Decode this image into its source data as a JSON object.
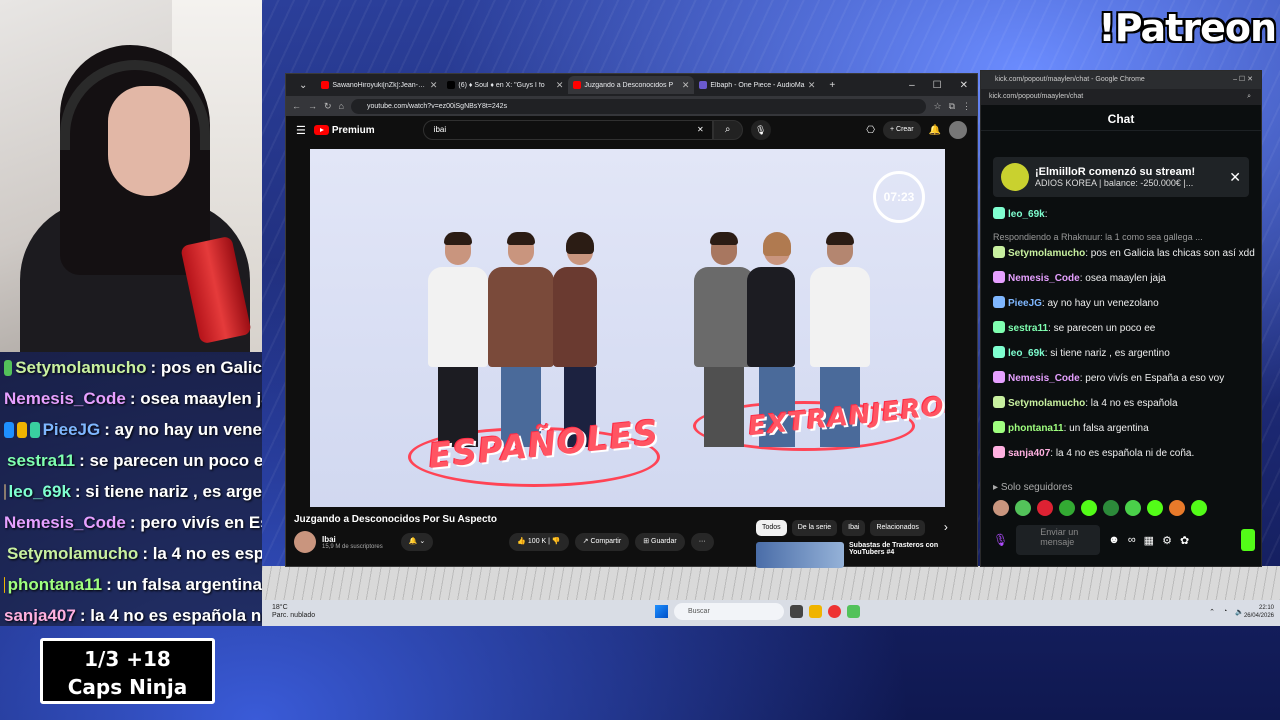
{
  "overlay": {
    "patreon_text": "!Patreon",
    "ninja": {
      "line1": "1/3   +18",
      "line2": "Caps Ninja"
    }
  },
  "left_chat": [
    {
      "user": "Setymolamucho",
      "text": ": pos en Galic",
      "color": "#c8f0a0",
      "badges": [
        "#53c25a"
      ]
    },
    {
      "user": "Nemesis_Code",
      "text": ": osea maaylen jaj",
      "color": "#e6a0ff",
      "badges": []
    },
    {
      "user": "PieeJG",
      "text": ": ay no hay un vene",
      "color": "#7fb7ff",
      "badges": [
        "#1e90ff",
        "#f0b400",
        "#39d0a0"
      ]
    },
    {
      "user": "sestra11",
      "text": ": se parecen un poco e",
      "color": "#7fffb0",
      "badges": [
        "#8a7b6d"
      ]
    },
    {
      "user": "leo_69k",
      "text": ": si tiene nariz , es arge",
      "color": "#7fffd0",
      "badges": [
        "#8a7b6d"
      ]
    },
    {
      "user": "Nemesis_Code",
      "text": ": pero vivís en Esp",
      "color": "#e6a0ff",
      "badges": []
    },
    {
      "user": "Setymolamucho",
      "text": ": la 4 no es esp",
      "color": "#c8f0a0",
      "badges": [
        "#1e90ff"
      ]
    },
    {
      "user": "phontana11",
      "text": ": un falsa argentina",
      "color": "#9fff7f",
      "badges": [
        "#f0b400"
      ]
    },
    {
      "user": "sanja407",
      "text": ": la 4 no es española ni c",
      "color": "#ffb0e0",
      "badges": []
    }
  ],
  "browser": {
    "tabs": [
      {
        "title": "SawanoHiroyuki[nZk]:Jean-Ken",
        "icon_color": "#ff0000",
        "active": false
      },
      {
        "title": "(6) ♦ Soul ♦ en X: \"Guys I fo",
        "icon_color": "#000000",
        "active": false
      },
      {
        "title": "Juzgando a Desconocidos P",
        "icon_color": "#ff0000",
        "active": true
      },
      {
        "title": "Elbaph - One Piece - AudioMa",
        "icon_color": "#6a5acd",
        "active": false
      }
    ],
    "url": "youtube.com/watch?v=ez00iSgNBsY8t=242s",
    "youtube": {
      "logo_label": "Premium",
      "search_value": "ibai",
      "create_label": "Crear",
      "timer": "07:23",
      "sign_left": "ESPAÑOLES",
      "sign_right": "EXTRANJEROS",
      "video_title": "Juzgando a Desconocidos Por Su Aspecto",
      "channel_name": "Ibai",
      "subscribers": "15,9 M de suscriptores",
      "likes": "100 K",
      "share_label": "Compartir",
      "save_label": "Guardar",
      "chips": [
        "Todos",
        "De la serie",
        "Ibai",
        "Relacionados"
      ],
      "rec_title_1": "Subastas de Trasteros con",
      "rec_title_2": "YouTubers #4",
      "rec_badge": "#4"
    }
  },
  "kick_chat": {
    "window_title": "kick.com/popout/maaylen/chat - Google Chrome",
    "url": "kick.com/popout/maaylen/chat",
    "header": "Chat",
    "notification": {
      "title": "¡ElmiilloR comenzó su stream!",
      "subtitle": "ADIOS KOREA | balance: -250.000€ |..."
    },
    "messages": [
      {
        "user": "leo_69k",
        "text": ":",
        "color": "#7fffd0",
        "reply": ""
      },
      {
        "user": "Setymolamucho",
        "text": ": pos en Galicia las chicas son así xdd",
        "color": "#c8f0a0",
        "reply": "Respondiendo a Rhaknuur: la 1 como sea gallega ..."
      },
      {
        "user": "Nemesis_Code",
        "text": ": osea maaylen jaja",
        "color": "#e6a0ff",
        "reply": ""
      },
      {
        "user": "PieeJG",
        "text": ": ay no hay un venezolano",
        "color": "#7fb7ff",
        "reply": ""
      },
      {
        "user": "sestra11",
        "text": ": se parecen un poco ee",
        "color": "#7fffb0",
        "reply": ""
      },
      {
        "user": "leo_69k",
        "text": ": si tiene nariz , es argentino",
        "color": "#7fffd0",
        "reply": ""
      },
      {
        "user": "Nemesis_Code",
        "text": ": pero vivís en España a eso voy",
        "color": "#e6a0ff",
        "reply": ""
      },
      {
        "user": "Setymolamucho",
        "text": ": la 4 no es española",
        "color": "#c8f0a0",
        "reply": ""
      },
      {
        "user": "phontana11",
        "text": ": un falsa argentina",
        "color": "#9fff7f",
        "reply": ""
      },
      {
        "user": "sanja407",
        "text": ": la 4 no es española ni de coña.",
        "color": "#ffb0e0",
        "reply": ""
      }
    ],
    "solo_label": "Solo seguidores",
    "input_placeholder": "Enviar un mensaje"
  },
  "taskbar": {
    "weather_temp": "18°C",
    "weather_desc": "Parc. nublado",
    "search_label": "Buscar",
    "time": "22:10",
    "date": "26/04/2026"
  }
}
